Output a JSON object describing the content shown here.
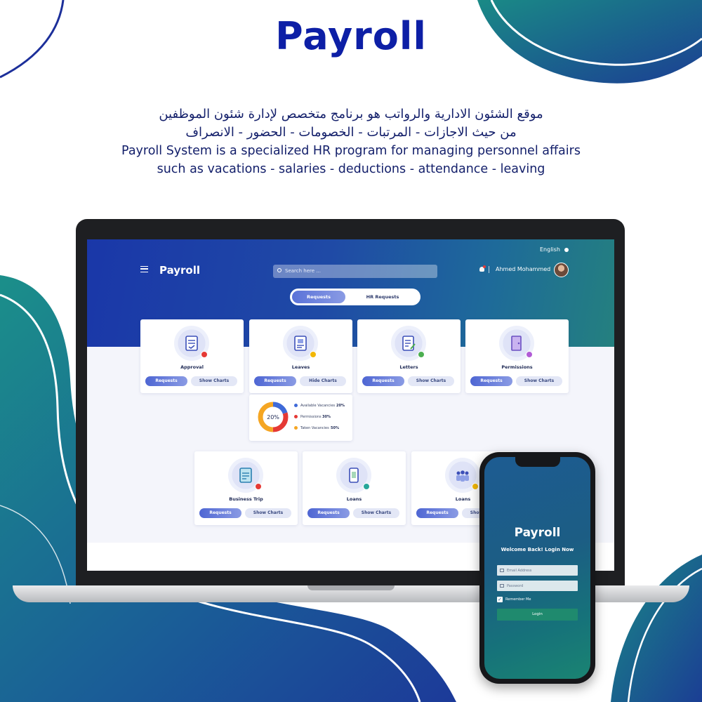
{
  "promo": {
    "brand_title": "Payroll",
    "arabic_line1": "موقع الشئون الادارية والرواتب هو برنامج متخصص لإدارة شئون الموظفين",
    "arabic_line2": "من حيث الاجازات - المرتبات - الخصومات - الحضور - الانصراف",
    "english_line1": "Payroll System is a specialized HR program for managing personnel affairs",
    "english_line2": "such as vacations - salaries - deductions - attendance - leaving"
  },
  "dashboard": {
    "language": "English",
    "app_logo": "Payroll",
    "search": {
      "placeholder": "Search here ..."
    },
    "user_name": "Ahmed Mohammed",
    "tabs": [
      {
        "label": "Requests",
        "active": true
      },
      {
        "label": "HR Requests",
        "active": false
      }
    ],
    "cards": [
      {
        "title": "Approval",
        "primary": "Requests",
        "secondary": "Show Charts",
        "icon": "document-check-icon",
        "badge_color": "#e53935"
      },
      {
        "title": "Leaves",
        "primary": "Requests",
        "secondary": "Hide Charts",
        "icon": "id-card-icon",
        "badge_color": "#f2b705"
      },
      {
        "title": "Letters",
        "primary": "Requests",
        "secondary": "Show Charts",
        "icon": "letter-edit-icon",
        "badge_color": "#4caf50"
      },
      {
        "title": "Permissions",
        "primary": "Requests",
        "secondary": "Show Charts",
        "icon": "door-key-icon",
        "badge_color": "#b15bd6"
      },
      {
        "title": "Business Trip",
        "primary": "Requests",
        "secondary": "Show Charts",
        "icon": "trip-document-icon",
        "badge_color": "#e53935"
      },
      {
        "title": "Loans",
        "primary": "Requests",
        "secondary": "Show Charts",
        "icon": "money-phone-icon",
        "badge_color": "#26a69a"
      },
      {
        "title": "Loans",
        "primary": "Requests",
        "secondary": "Show Charts",
        "icon": "team-icon",
        "badge_color": "#f2b705"
      }
    ],
    "leaves_chart": {
      "center_label": "20%",
      "items": [
        {
          "label": "Available Vacancies",
          "value": "20%",
          "color": "#3f6ad8"
        },
        {
          "label": "Permissions",
          "value": "30%",
          "color": "#e53935"
        },
        {
          "label": "Taken Vacancies",
          "value": "50%",
          "color": "#f5a623"
        }
      ]
    }
  },
  "chart_data": {
    "type": "pie",
    "categories": [
      "Available Vacancies",
      "Permissions",
      "Taken Vacancies"
    ],
    "values": [
      20,
      30,
      50
    ],
    "colors": [
      "#3f6ad8",
      "#e53935",
      "#f5a623"
    ]
  },
  "phone": {
    "logo": "Payroll",
    "welcome": "Welcome Back! Login Now",
    "email_placeholder": "Email Address",
    "password_placeholder": "Password",
    "remember": "Remember Me",
    "login": "Login"
  }
}
